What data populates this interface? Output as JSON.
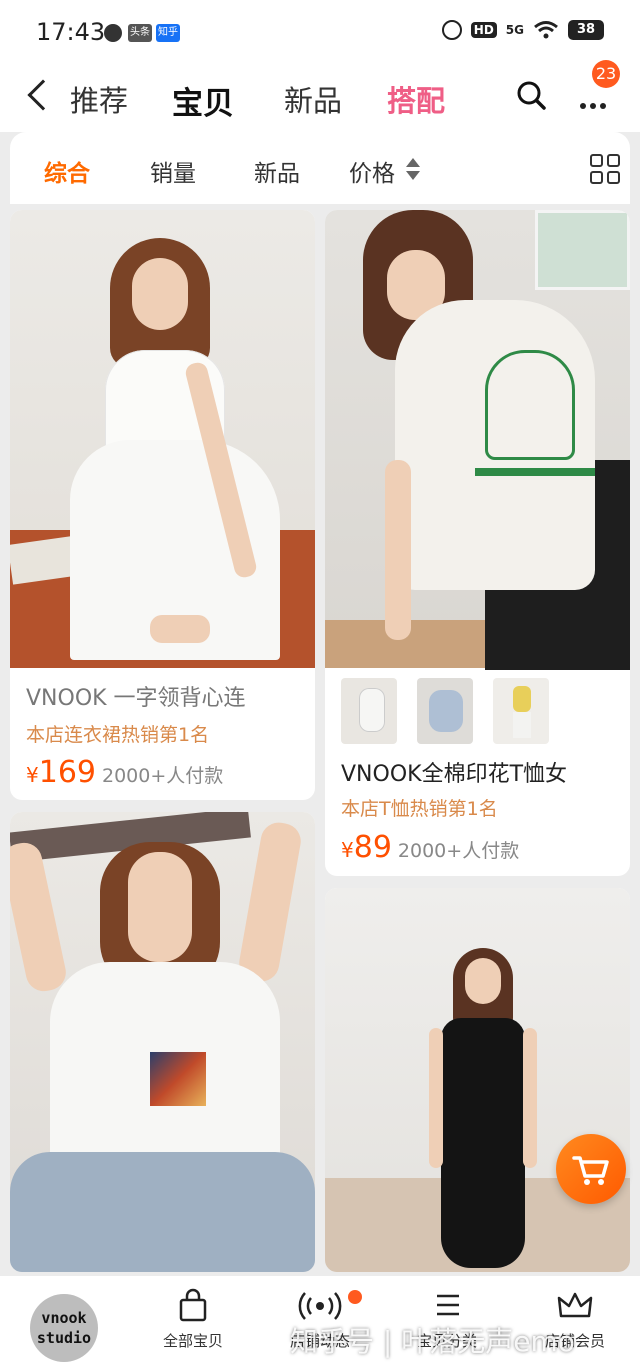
{
  "status_bar": {
    "time": "17:43",
    "apps": [
      "头条",
      "知乎"
    ],
    "hd": "HD",
    "signal": "5G",
    "battery": "38"
  },
  "nav": {
    "tabs": [
      "推荐",
      "宝贝",
      "新品",
      "搭配"
    ],
    "active_tab": "宝贝",
    "badge_count": "23"
  },
  "sort_bar": {
    "options": [
      "综合",
      "销量",
      "新品",
      "价格"
    ],
    "active": "综合"
  },
  "products": [
    {
      "title": "VNOOK 一字领背心连",
      "rank": "本店连衣裙热销第1名",
      "currency": "¥",
      "price": "169",
      "sold": "2000+人付款"
    },
    {
      "title": "VNOOK全棉印花T恤女",
      "rank": "本店T恤热销第1名",
      "currency": "¥",
      "price": "89",
      "sold": "2000+人付款"
    }
  ],
  "bottom_bar": {
    "logo_line1": "vnook",
    "logo_line2": "studio",
    "items": [
      "全部宝贝",
      "店铺动态",
      "宝贝分类",
      "店铺会员"
    ]
  },
  "watermark": "知乎号 | 叶落无声emo",
  "colors": {
    "accent_orange": "#ff6a00",
    "price_red": "#ff5000",
    "tab_pink": "#ef5e86",
    "rank_tan": "#d98a4b"
  }
}
